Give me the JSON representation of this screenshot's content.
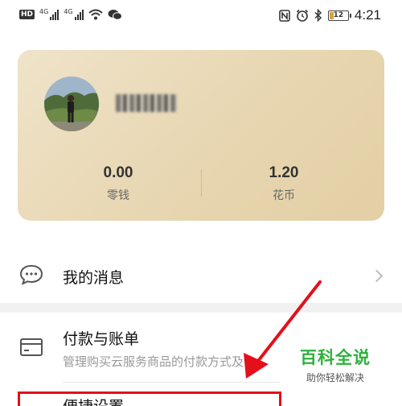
{
  "status_bar": {
    "hd_badge": "HD",
    "network_1": "4G",
    "network_2": "4G",
    "time": "4:21",
    "battery_level": "12",
    "icons": [
      "hd-icon",
      "signal-icon",
      "wifi-icon",
      "wechat-icon",
      "nfc-icon",
      "alarm-icon",
      "bluetooth-icon",
      "battery-icon"
    ]
  },
  "profile": {
    "username": "",
    "balance_value": "0.00",
    "balance_label": "零钱",
    "coins_value": "1.20",
    "coins_label": "花币"
  },
  "menu": {
    "messages_label": "我的消息",
    "billing_label": "付款与账单",
    "billing_subtitle": "管理购买云服务商品的付款方式及",
    "shortcut_label": "便捷设置"
  },
  "watermark": {
    "title": "百科全说",
    "subtitle": "助你轻松解决"
  },
  "colors": {
    "card_gold": "#e7d6b1",
    "highlight_red": "#e3101a",
    "watermark_green": "#2fb13c"
  }
}
